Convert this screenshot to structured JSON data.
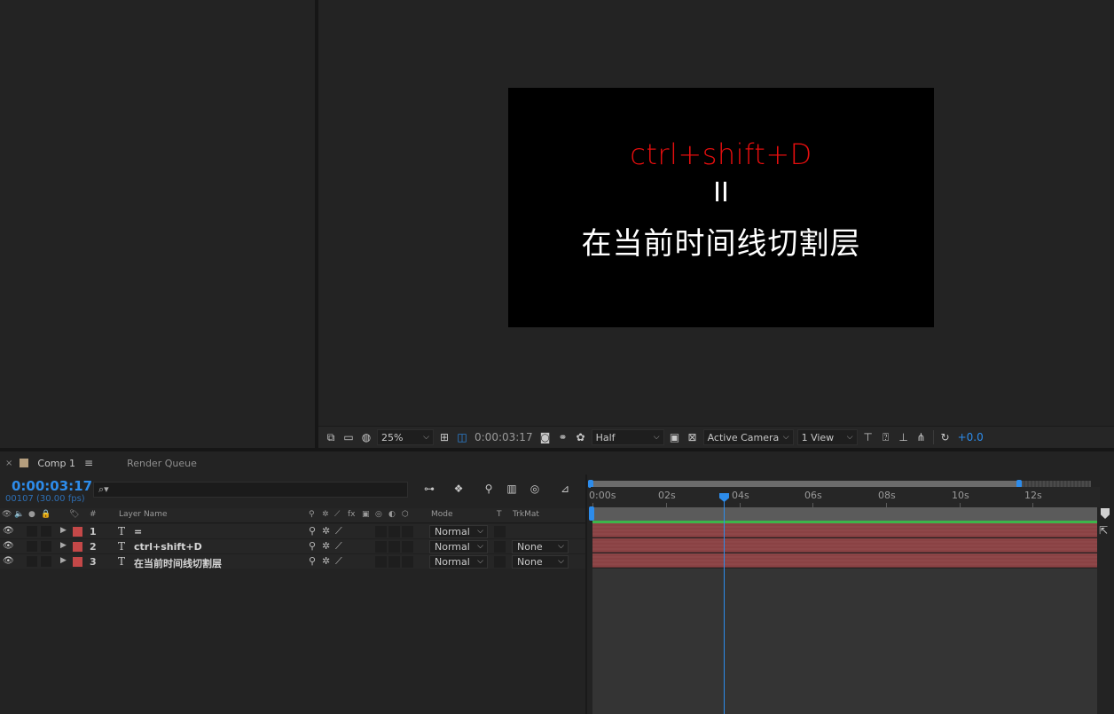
{
  "canvas": {
    "line1": "ctrl+shift+D",
    "line2": "II",
    "line3": "在当前时间线切割层"
  },
  "viewer_toolbar": {
    "zoom": "25%",
    "timecode": "0:00:03:17",
    "resolution": "Half",
    "camera": "Active Camera",
    "views": "1 View",
    "exposure": "+0.0"
  },
  "timeline": {
    "tab_label": "Comp 1",
    "render_queue_label": "Render Queue",
    "current_time": "0:00:03:17",
    "frame_info": "00107 (30.00 fps)",
    "search_placeholder": "⌕▾",
    "columns": {
      "hash": "#",
      "layer_name": "Layer Name",
      "mode": "Mode",
      "t": "T",
      "trkmat": "TrkMat"
    },
    "layers": [
      {
        "num": "1",
        "name": "=",
        "mode": "Normal",
        "trkmat": ""
      },
      {
        "num": "2",
        "name": "ctrl+shift+D",
        "mode": "Normal",
        "trkmat": "None"
      },
      {
        "num": "3",
        "name": "在当前时间线切割层",
        "mode": "Normal",
        "trkmat": "None"
      }
    ],
    "ruler_labels": [
      "0:00s",
      "02s",
      "04s",
      "06s",
      "08s",
      "10s",
      "12s"
    ]
  },
  "colors": {
    "accent": "#2d8ceb",
    "layer_label": "#c44848",
    "layer_bar": "#8a4244",
    "canvas_red": "#e60e0e"
  }
}
